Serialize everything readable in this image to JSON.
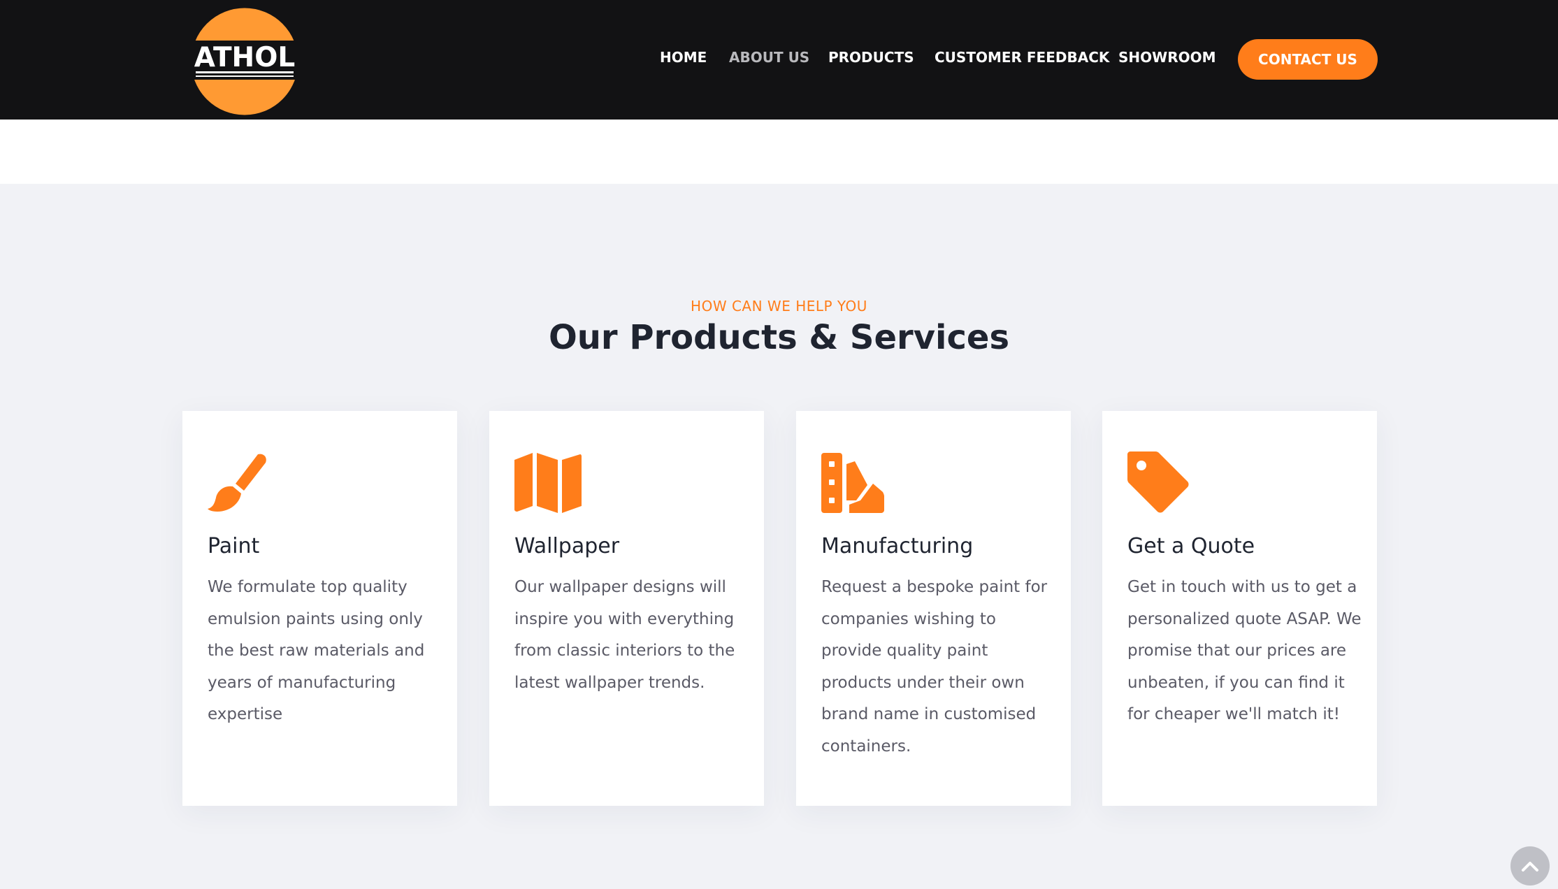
{
  "brand": {
    "logo_text": "ATHOL",
    "accent_color": "#ff7d1a",
    "header_bg": "#121214"
  },
  "nav": {
    "items": [
      {
        "label": "HOME"
      },
      {
        "label": "ABOUT US"
      },
      {
        "label": "PRODUCTS"
      },
      {
        "label": "CUSTOMER FEEDBACK"
      },
      {
        "label": "SHOWROOM"
      }
    ],
    "cta_label": "CONTACT US"
  },
  "section": {
    "kicker": "HOW CAN WE HELP YOU",
    "title": "Our Products & Services"
  },
  "cards": [
    {
      "icon": "paint-brush-icon",
      "title": "Paint",
      "text": "We formulate top quality emulsion paints using only the best raw materials and years of manufacturing expertise"
    },
    {
      "icon": "map-icon",
      "title": "Wallpaper",
      "text": "Our wallpaper designs will inspire you with everything from classic interiors to the latest wallpaper trends."
    },
    {
      "icon": "swatchbook-icon",
      "title": "Manufacturing",
      "text": "Request a bespoke paint for companies wishing to provide quality paint products under their own brand name in customised containers."
    },
    {
      "icon": "tag-icon",
      "title": "Get a Quote",
      "text": "Get in touch with us to get a personalized quote ASAP. We promise that our prices are unbeaten, if you can find it for cheaper we'll match it!"
    }
  ],
  "scroll_top": {
    "icon": "chevron-up-icon"
  }
}
